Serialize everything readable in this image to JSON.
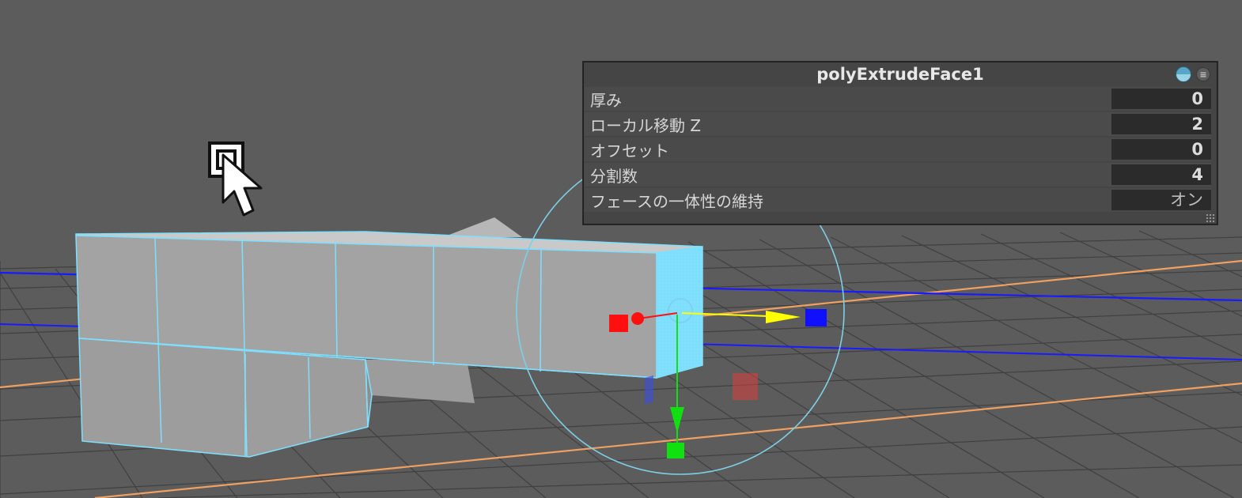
{
  "channel_box": {
    "title": "polyExtrudeFace1",
    "attributes": [
      {
        "label": "厚み",
        "value": "0"
      },
      {
        "label": "ローカル移動 Z",
        "value": "2"
      },
      {
        "label": "オフセット",
        "value": "0"
      },
      {
        "label": "分割数",
        "value": "4"
      },
      {
        "label": "フェースの一体性の維持",
        "value": "オン"
      }
    ]
  },
  "colors": {
    "background": "#5c5c5c",
    "mesh_wire": "#7ee0ff",
    "grid": "#3f3f3f",
    "axis_x": "#f0a060",
    "axis_z": "#1a1aff",
    "manip_x": "#ff1010",
    "manip_y": "#10e010",
    "manip_z": "#1010ff",
    "manip_yellow": "#ffff00"
  },
  "icons": [
    "display-toggle-icon",
    "menu-icon",
    "mouse-cursor-icon",
    "select-tool-icon",
    "extrude-manipulator-icon"
  ]
}
